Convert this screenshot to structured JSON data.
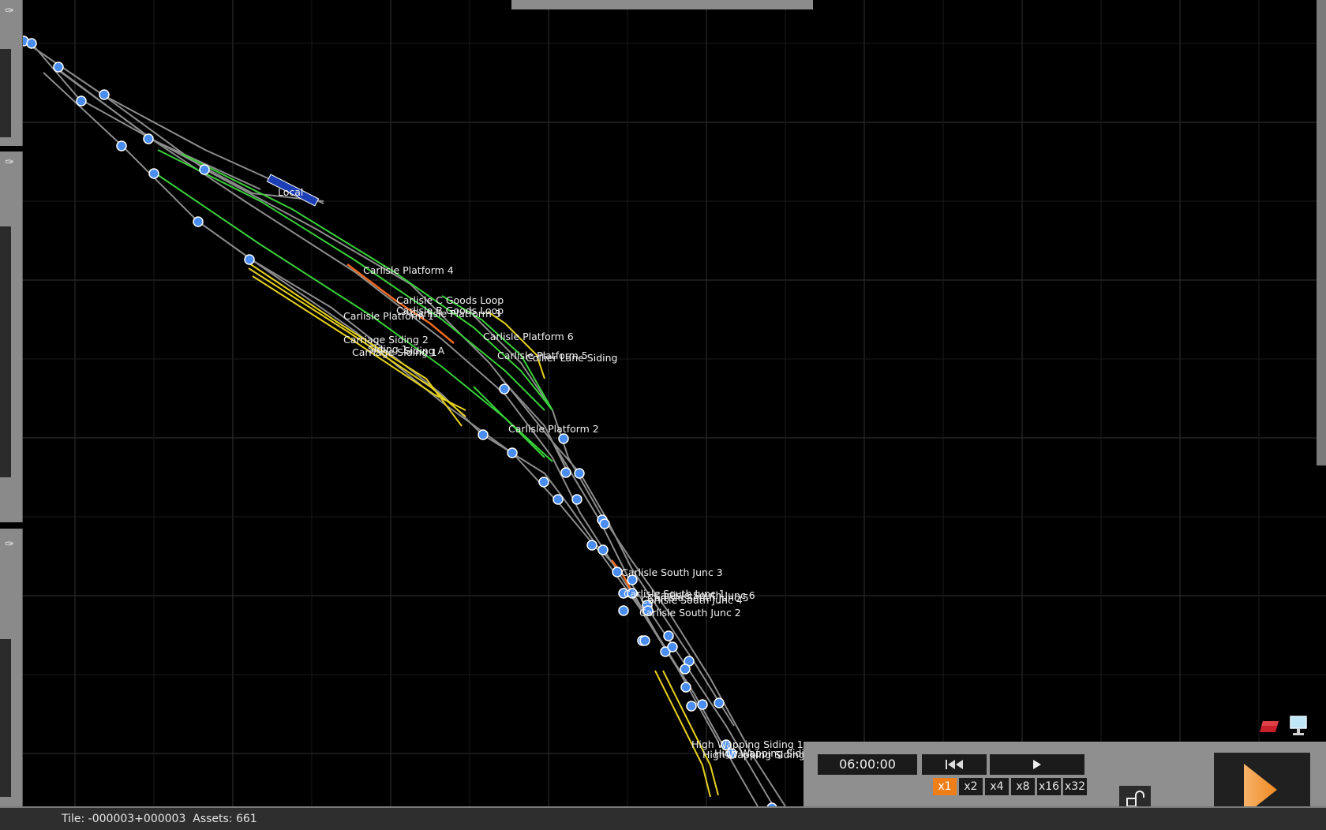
{
  "map": {
    "train_label": "Local",
    "labels": [
      "Carlisle Platform 4",
      "Carlisle C Goods Loop",
      "Carlisle B Goods Loop",
      "Carlisle Platform 1",
      "Carlisle Platform 3",
      "Carriage Siding 2",
      "Carriage Siding 1",
      "Siding 1",
      "Siding A",
      "Carlisle Platform 6",
      "Carlisle Platform 5",
      "Collier Lane Siding",
      "Carlisle Platform 2",
      "Carlisle South Junc 3",
      "Carlisle South Junc 1",
      "Carlisle South Junc 6",
      "Carlisle South Junc 4",
      "Carlisle South Junc 5",
      "Carlisle South Junc 2",
      "High Wapping Siding 1",
      "High Wapping Siding 2",
      "High Wapping Siding 3"
    ],
    "colors": {
      "track": "#8c8c8c",
      "platform": "#39d13a",
      "siding": "#e6d31c",
      "junction": "#ef6a1f",
      "node": "#4a8df0",
      "train": "#1d3fb5"
    }
  },
  "status": {
    "text": "Tile: -000003+000003  Assets: 661"
  },
  "control": {
    "time": "06:00:00",
    "rewind_icon": "rewind-icon",
    "play_icon": "play-icon",
    "speeds": [
      "x1",
      "x2",
      "x4",
      "x8",
      "x16",
      "x32"
    ],
    "active_speed": "x1"
  },
  "icons": {
    "pin": "pin-icon",
    "lock": "unlock-icon",
    "eraser": "eraser-icon",
    "monitor": "monitor-icon",
    "big_play": "big-play-icon"
  }
}
